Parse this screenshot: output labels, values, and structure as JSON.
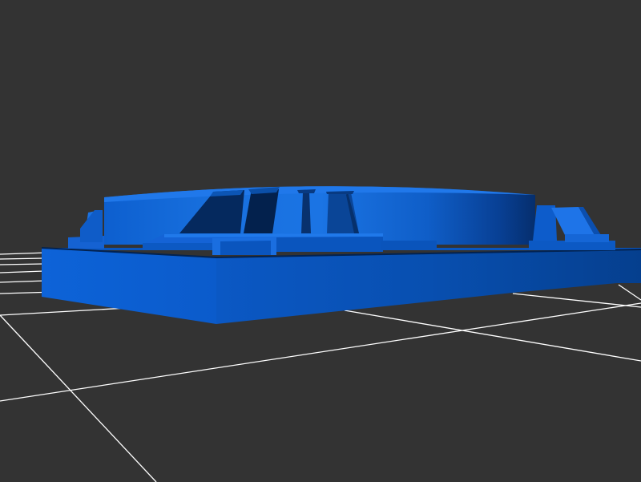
{
  "scene": {
    "background_color": "#333333",
    "grid_color": "#ffffff",
    "model_color_light": "#1e6fe0",
    "model_color_mid": "#0a5ac8",
    "model_color_dark": "#053d8e",
    "model_color_darkest": "#022a63"
  }
}
